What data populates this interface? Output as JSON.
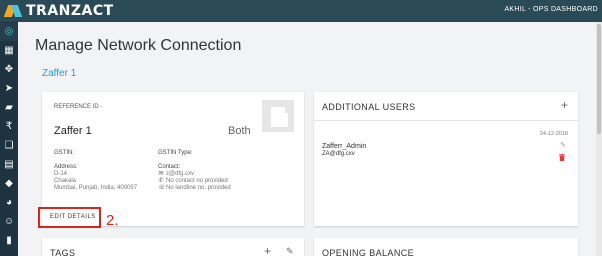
{
  "app": {
    "brand": "TRANZACT",
    "user_label": "AKHIL - OPS DASHBOARD"
  },
  "sidebar": {
    "items": [
      {
        "icon": "globe-icon",
        "glyph": "◎",
        "active": true
      },
      {
        "icon": "store-icon",
        "glyph": "▦",
        "active": false
      },
      {
        "icon": "network-icon",
        "glyph": "✥",
        "active": false
      },
      {
        "icon": "send-icon",
        "glyph": "➤",
        "active": false
      },
      {
        "icon": "truck-icon",
        "glyph": "▰",
        "active": false
      },
      {
        "icon": "rupee-icon",
        "glyph": "₹",
        "active": false
      },
      {
        "icon": "documents-icon",
        "glyph": "❏",
        "active": false
      },
      {
        "icon": "invoice-icon",
        "glyph": "▤",
        "active": false
      },
      {
        "icon": "box-icon",
        "glyph": "◆",
        "active": false
      },
      {
        "icon": "analytics-icon",
        "glyph": "◕",
        "active": false
      },
      {
        "icon": "users-icon",
        "glyph": "☺",
        "active": false
      },
      {
        "icon": "report-icon",
        "glyph": "▮",
        "active": false
      }
    ]
  },
  "page": {
    "title": "Manage Network Connection",
    "breadcrumb": "Zaffer 1"
  },
  "company": {
    "reference_label": "REFERENCE ID -",
    "name": "Zaffer 1",
    "type": "Both",
    "gstin_label": "GSTIN:",
    "gstin_type_label": "GSTIN Type:",
    "address_label": "Address:",
    "address_lines": [
      "D-14",
      "Chakala",
      "Mumbai, Punjab, India, 400097"
    ],
    "contact_label": "Contact:",
    "contact_email": "z@dfg.cxv",
    "contact_phone": "No contact no provided",
    "contact_landline": "No landline no. provided",
    "edit_button": "EDIT DETAILS"
  },
  "annotation": {
    "step": "2.",
    "color": "#d9261c"
  },
  "additional_users": {
    "title": "ADDITIONAL USERS",
    "add_icon": "+",
    "users": [
      {
        "date": "24-12-2018",
        "name": "Zafferr_Admin",
        "email": "ZA@dfg.cxv"
      }
    ]
  },
  "tags": {
    "title": "TAGS",
    "add_icon": "+"
  },
  "opening_balance": {
    "title": "OPENING BALANCE"
  },
  "colors": {
    "topbar": "#2b4a58",
    "sidebar": "#1d3340",
    "accent": "#2b9bd6",
    "danger": "#d9261c"
  }
}
